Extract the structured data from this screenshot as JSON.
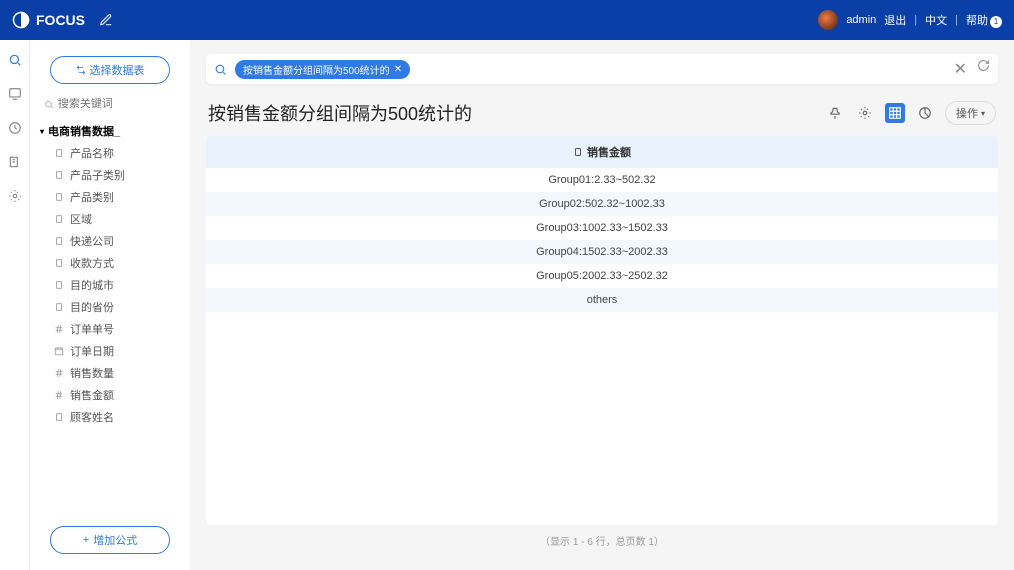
{
  "app": {
    "name": "FOCUS"
  },
  "header": {
    "user": "admin",
    "logout": "退出",
    "lang": "中文",
    "help": "帮助"
  },
  "sidebar": {
    "select_table": "选择数据表",
    "search_placeholder": "搜索关键词",
    "dataset": "电商销售数据_",
    "fields": [
      "产品名称",
      "产品子类别",
      "产品类别",
      "区域",
      "快递公司",
      "收款方式",
      "目的城市",
      "目的省份",
      "订单单号",
      "订单日期",
      "销售数量",
      "销售金额",
      "顾客姓名"
    ],
    "add_formula": "增加公式"
  },
  "search": {
    "chip": "按销售金额分组间隔为500统计的"
  },
  "title": "按销售金额分组间隔为500统计的",
  "ops_label": "操作",
  "table": {
    "header": "销售金额",
    "rows": [
      "Group01:2.33~502.32",
      "Group02:502.32~1002.33",
      "Group03:1002.33~1502.33",
      "Group04:1502.33~2002.33",
      "Group05:2002.33~2502.32",
      "others"
    ]
  },
  "pager": "（显示 1 - 6 行，总页数 1）"
}
